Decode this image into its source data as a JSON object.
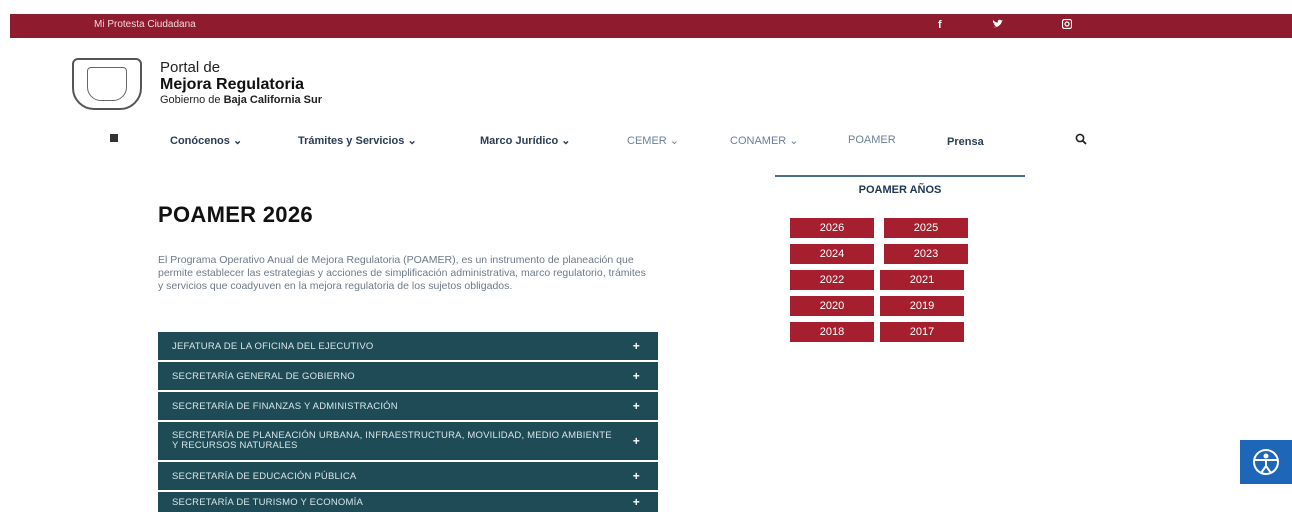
{
  "topbar": {
    "protesta": "Mi Protesta Ciudadana",
    "social_icons": [
      "facebook-icon",
      "twitter-icon",
      "instagram-icon"
    ]
  },
  "brand": {
    "line1": "Portal de",
    "line2": "Mejora Regulatoria",
    "line3_prefix": "Gobierno de ",
    "line3_bold": "Baja California Sur"
  },
  "nav": {
    "items": [
      {
        "label": "Conócenos ⌄"
      },
      {
        "label": "Trámites y Servicios ⌄"
      },
      {
        "label": "Marco Jurídico ⌄"
      },
      {
        "label": "CEMER ⌄"
      },
      {
        "label": "CONAMER ⌄"
      },
      {
        "label": "POAMER"
      },
      {
        "label": "Prensa"
      }
    ]
  },
  "main": {
    "title": "POAMER 2026",
    "intro": "El Programa Operativo Anual de Mejora Regulatoria (POAMER), es un instrumento de planeación que permite establecer las estrategias y acciones de simplificación administrativa, marco regulatorio, trámites y servicios que coadyuven en la mejora regulatoria de los sujetos obligados.",
    "accordion": [
      {
        "label": "JEFATURA DE LA OFICINA DEL EJECUTIVO"
      },
      {
        "label": "SECRETARÍA GENERAL DE GOBIERNO"
      },
      {
        "label": "SECRETARÍA DE FINANZAS Y ADMINISTRACIÓN"
      },
      {
        "label": "SECRETARÍA DE PLANEACIÓN URBANA, INFRAESTRUCTURA, MOVILIDAD, MEDIO AMBIENTE Y RECURSOS NATURALES"
      },
      {
        "label": "SECRETARÍA DE EDUCACIÓN PÚBLICA"
      },
      {
        "label": "SECRETARÍA DE TURISMO Y ECONOMÍA"
      }
    ]
  },
  "sidebar": {
    "title": "POAMER AÑOS",
    "years": [
      "2026",
      "2025",
      "2024",
      "2023",
      "2022",
      "2021",
      "2020",
      "2019",
      "2018",
      "2017"
    ]
  },
  "colors": {
    "topbar": "#8e1b2e",
    "accordion": "#1f4b57",
    "year_button": "#a51f2e",
    "accessibility": "#1e66b8"
  }
}
